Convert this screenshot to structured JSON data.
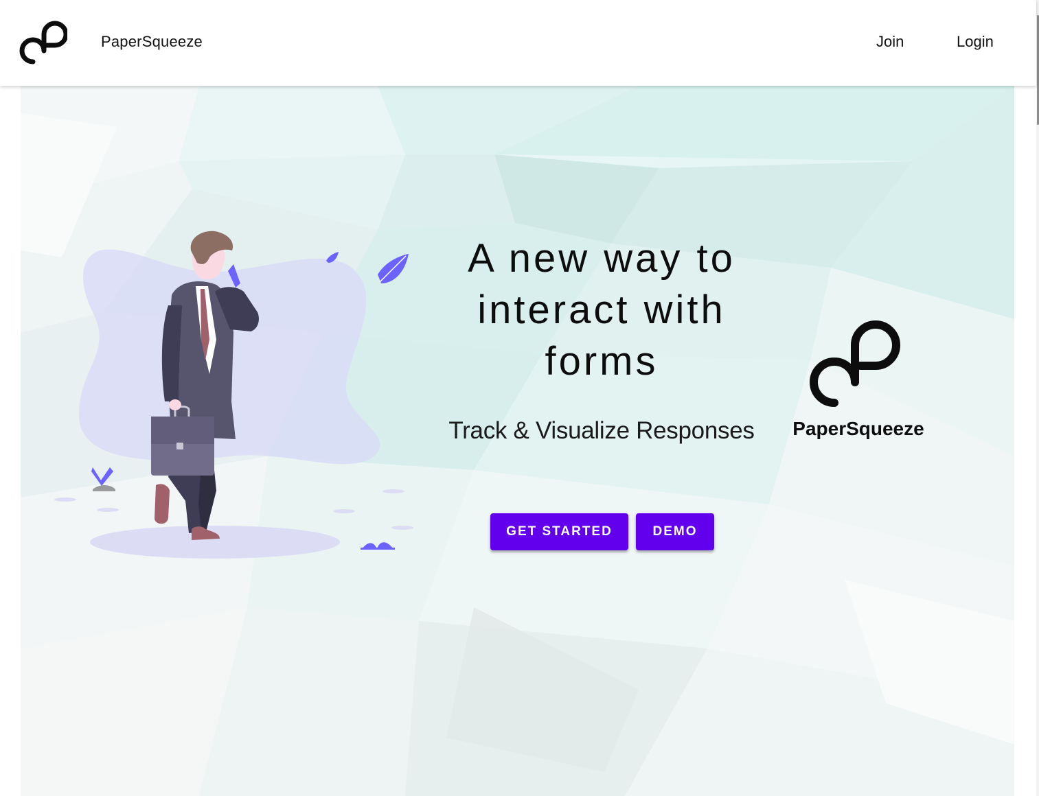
{
  "header": {
    "app_name": "PaperSqueeze",
    "nav": {
      "join": "Join",
      "login": "Login"
    }
  },
  "hero": {
    "headline_lines": [
      "A new way to",
      "interact with",
      "forms"
    ],
    "subtitle": "Track & Visualize Responses",
    "brand_name": "PaperSqueeze",
    "buttons": {
      "get_started": "GET STARTED",
      "demo": "DEMO"
    }
  },
  "colors": {
    "accent": "#6200ee",
    "illustration_purple": "#6c63ff",
    "text": "#0d0d0d"
  },
  "icons": [
    "papersqueeze-logo-icon",
    "leaf-icon",
    "plant-icon",
    "briefcase-icon",
    "phone-icon"
  ]
}
